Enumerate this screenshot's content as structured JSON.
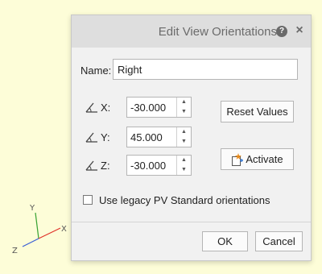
{
  "triad": {
    "x_label": "X",
    "y_label": "Y",
    "z_label": "Z",
    "x_color": "#e0322a",
    "y_color": "#3aa334",
    "z_color": "#3a5fd6"
  },
  "dialog": {
    "title": "Edit View Orientations",
    "help_icon": "?",
    "close_icon": "×",
    "name": {
      "label": "Name:",
      "value": "Right"
    },
    "axes": [
      {
        "label": "X:",
        "value": "-30.000"
      },
      {
        "label": "Y:",
        "value": "45.000"
      },
      {
        "label": "Z:",
        "value": "-30.000"
      }
    ],
    "spin_up": "▲",
    "spin_down": "▼",
    "reset_label": "Reset Values",
    "activate_label": "Activate",
    "legacy_checkbox": {
      "label": "Use legacy PV Standard orientations",
      "checked": false
    },
    "ok_label": "OK",
    "cancel_label": "Cancel"
  }
}
